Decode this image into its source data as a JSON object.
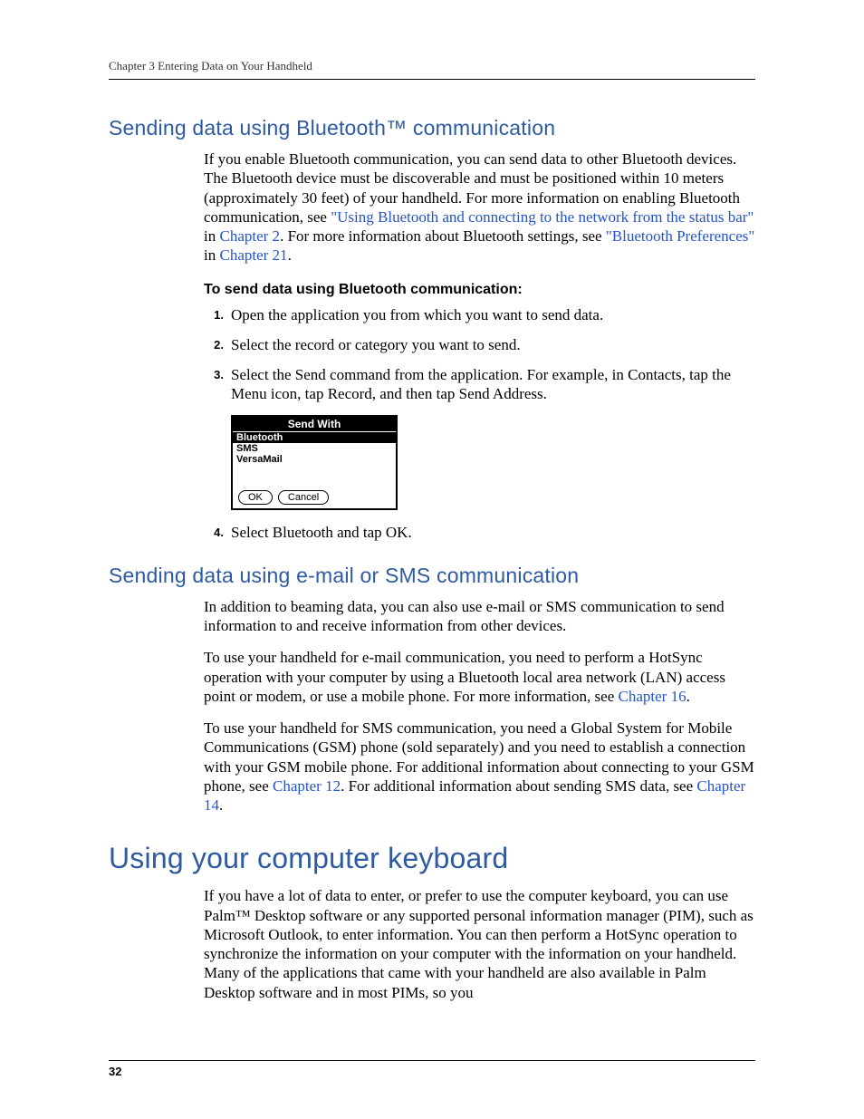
{
  "header": {
    "running": "Chapter 3   Entering Data on Your Handheld"
  },
  "section1": {
    "title": "Sending data using Bluetooth™ communication",
    "para1_a": "If you enable Bluetooth communication, you can send data to other Bluetooth devices. The Bluetooth device must be discoverable and must be positioned within 10 meters (approximately 30 feet) of your handheld. For more information on enabling Bluetooth communication, see ",
    "link1": "\"Using Bluetooth and connecting to the network from the status bar\"",
    "para1_b": " in ",
    "link2": "Chapter 2",
    "para1_c": ". For more information about Bluetooth settings, see ",
    "link3": "\"Bluetooth Preferences\"",
    "para1_d": " in ",
    "link4": "Chapter 21",
    "para1_e": ".",
    "subhead": "To send data using Bluetooth communication:",
    "step1": "Open the application you from which you want to send data.",
    "step2": "Select the record or category you want to send.",
    "step3": "Select the Send command from the application. For example, in Contacts, tap the Menu icon, tap Record, and then tap Send Address.",
    "step4": "Select Bluetooth and tap OK."
  },
  "screenshot": {
    "title": "Send With",
    "items": [
      "Bluetooth",
      "SMS",
      "VersaMail"
    ],
    "ok": "OK",
    "cancel": "Cancel"
  },
  "section2": {
    "title": "Sending data using e-mail or SMS communication",
    "para1": "In addition to beaming data, you can also use e-mail or SMS communication to send information to and receive information from other devices.",
    "para2_a": "To use your handheld for e-mail communication, you need to perform a HotSync operation with your computer by using a Bluetooth local area network (LAN) access point or modem, or use a mobile phone. For more information, see ",
    "link1": "Chapter 16",
    "para2_b": ".",
    "para3_a": "To use your handheld for SMS communication, you need a Global System for Mobile Communications (GSM) phone (sold separately) and you need to establish a connection with your GSM mobile phone. For additional information about connecting to your GSM phone, see ",
    "link2": "Chapter 12",
    "para3_b": ". For additional information about sending SMS data, see ",
    "link3": "Chapter 14",
    "para3_c": "."
  },
  "section3": {
    "title": "Using your computer keyboard",
    "para1": "If you have a lot of data to enter, or prefer to use the computer keyboard, you can use Palm™ Desktop software or any supported personal information manager (PIM), such as Microsoft Outlook, to enter information. You can then perform a HotSync operation to synchronize the information on your computer with the information on your handheld. Many of the applications that came with your handheld are also available in Palm Desktop software and in most PIMs, so you"
  },
  "page_number": "32",
  "nums": {
    "n1": "1.",
    "n2": "2.",
    "n3": "3.",
    "n4": "4."
  }
}
